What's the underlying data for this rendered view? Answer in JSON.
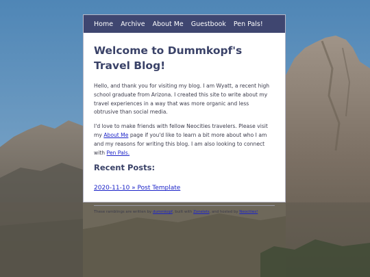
{
  "nav": {
    "items": [
      {
        "label": "Home"
      },
      {
        "label": "Archive"
      },
      {
        "label": "About Me"
      },
      {
        "label": "Guestbook"
      },
      {
        "label": "Pen Pals!"
      }
    ]
  },
  "main": {
    "title": "Welcome to Dummkopf's Travel Blog!",
    "intro": "Hello, and thank you for visiting my blog. I am Wyatt, a recent high school graduate from Arizona. I created this site to write about my travel experiences in a way that was more organic and less obtrusive than social media.",
    "para2_a": "I'd love to make friends with fellow Neocities travelers. Please visit my ",
    "para2_link1": "About Me",
    "para2_b": " page if you'd like to learn a bit more about who I am and my reasons for writing this blog. I am also looking to connect with ",
    "para2_link2": "Pen Pals.",
    "recent_heading": "Recent Posts:",
    "posts": [
      {
        "label": "2020-11-10 » Post Template"
      }
    ]
  },
  "footer": {
    "text_a": "These ramblings are written by ",
    "link_author": "dummkopf",
    "text_b": ", built with ",
    "link_builder": "Zonelets",
    "text_c": ", and hosted by ",
    "link_host": "Neocities!"
  },
  "colors": {
    "nav_bg": "#3f4670",
    "heading": "#3a4268",
    "link": "#1a22c8",
    "sky": "#5f8fb8"
  }
}
